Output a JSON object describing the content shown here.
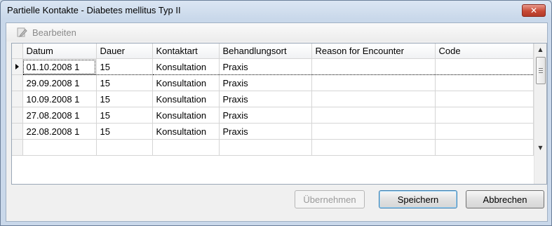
{
  "window": {
    "title": "Partielle Kontakte - Diabetes mellitus Typ II",
    "close_label": "✕"
  },
  "toolbar": {
    "edit_label": "Bearbeiten"
  },
  "grid": {
    "columns": [
      "Datum",
      "Dauer",
      "Kontaktart",
      "Behandlungsort",
      "Reason for Encounter",
      "Code"
    ],
    "rows": [
      [
        "01.10.2008 1",
        "15",
        "Konsultation",
        "Praxis",
        "",
        ""
      ],
      [
        "29.09.2008 1",
        "15",
        "Konsultation",
        "Praxis",
        "",
        ""
      ],
      [
        "10.09.2008 1",
        "15",
        "Konsultation",
        "Praxis",
        "",
        ""
      ],
      [
        "27.08.2008 1",
        "15",
        "Konsultation",
        "Praxis",
        "",
        ""
      ],
      [
        "22.08.2008 1",
        "15",
        "Konsultation",
        "Praxis",
        "",
        ""
      ]
    ]
  },
  "buttons": {
    "apply_label": "Übernehmen",
    "save_label": "Speichern",
    "cancel_label": "Abbrechen"
  }
}
